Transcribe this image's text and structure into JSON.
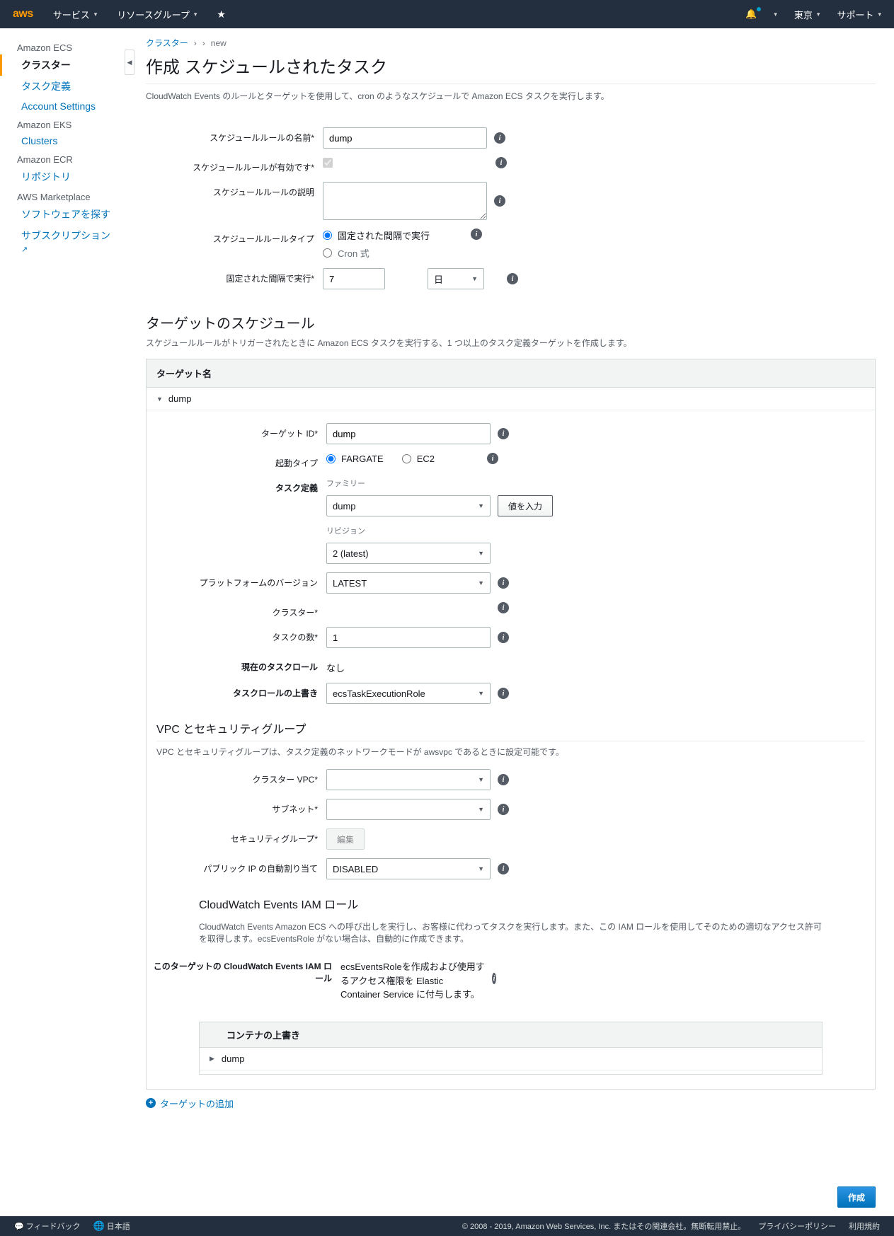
{
  "topnav": {
    "logo": "aws",
    "services": "サービス",
    "resource_groups": "リソースグループ",
    "region": "東京",
    "support": "サポート"
  },
  "sidebar": {
    "ecs": "Amazon ECS",
    "clusters": "クラスター",
    "task_def": "タスク定義",
    "account_settings": "Account Settings",
    "eks": "Amazon EKS",
    "eks_clusters": "Clusters",
    "ecr": "Amazon ECR",
    "repositories": "リポジトリ",
    "marketplace": "AWS Marketplace",
    "find_software": "ソフトウェアを探す",
    "subscriptions": "サブスクリプション"
  },
  "breadcrumb": {
    "clusters": "クラスター",
    "sep": "›",
    "current": "new"
  },
  "page": {
    "title": "作成 スケジュールされたタスク",
    "desc": "CloudWatch Events のルールとターゲットを使用して、cron のようなスケジュールで Amazon ECS タスクを実行します。"
  },
  "form": {
    "rule_name_label": "スケジュールルールの名前*",
    "rule_name_value": "dump",
    "rule_enabled_label": "スケジュールルールが有効です*",
    "rule_desc_label": "スケジュールルールの説明",
    "rule_type_label": "スケジュールルールタイプ",
    "rule_type_fixed": "固定された間隔で実行",
    "rule_type_cron": "Cron 式",
    "fixed_label": "固定された間隔で実行*",
    "fixed_value": "7",
    "fixed_unit": "日"
  },
  "schedule": {
    "title": "ターゲットのスケジュール",
    "desc": "スケジュールルールがトリガーされたときに Amazon ECS タスクを実行する、1 つ以上のタスク定義ターゲットを作成します。",
    "panel_header": "ターゲット名",
    "target_name": "dump"
  },
  "target": {
    "id_label": "ターゲット ID*",
    "id_value": "dump",
    "launch_label": "起動タイプ",
    "launch_fargate": "FARGATE",
    "launch_ec2": "EC2",
    "task_def_label": "タスク定義",
    "family_mini": "ファミリー",
    "family_value": "dump",
    "rev_mini": "リビジョン",
    "rev_value": "2 (latest)",
    "enter_value_btn": "値を入力",
    "platform_label": "プラットフォームのバージョン",
    "platform_value": "LATEST",
    "cluster_label": "クラスター*",
    "tasks_label": "タスクの数*",
    "tasks_value": "1",
    "current_role_label": "現在のタスクロール",
    "current_role_value": "なし",
    "override_role_label": "タスクロールの上書き",
    "override_role_value": "ecsTaskExecutionRole"
  },
  "vpc": {
    "title": "VPC とセキュリティグループ",
    "desc": "VPC とセキュリティグループは、タスク定義のネットワークモードが awsvpc であるときに設定可能です。",
    "vpc_label": "クラスター VPC*",
    "subnet_label": "サブネット*",
    "sg_label": "セキュリティグループ*",
    "sg_edit": "編集",
    "pubip_label": "パブリック IP の自動割り当て",
    "pubip_value": "DISABLED"
  },
  "iam": {
    "title": "CloudWatch Events IAM ロール",
    "desc": "CloudWatch Events Amazon ECS への呼び出しを実行し、お客様に代わってタスクを実行します。また、この IAM ロールを使用してそのための適切なアクセス許可を取得します。ecsEventsRole がない場合は、自動的に作成できます。",
    "role_label": "このターゲットの CloudWatch Events IAM ロール",
    "role_value": "ecsEventsRoleを作成および使用するアクセス権限を Elastic Container Service に付与します。"
  },
  "container_override": {
    "header": "コンテナの上書き",
    "item": "dump"
  },
  "add_target": "ターゲットの追加",
  "create_btn": "作成",
  "footer": {
    "feedback": "フィードバック",
    "language": "日本語",
    "copyright": "© 2008 - 2019, Amazon Web Services, Inc. またはその関連会社。無断転用禁止。",
    "privacy": "プライバシーポリシー",
    "terms": "利用規約"
  }
}
